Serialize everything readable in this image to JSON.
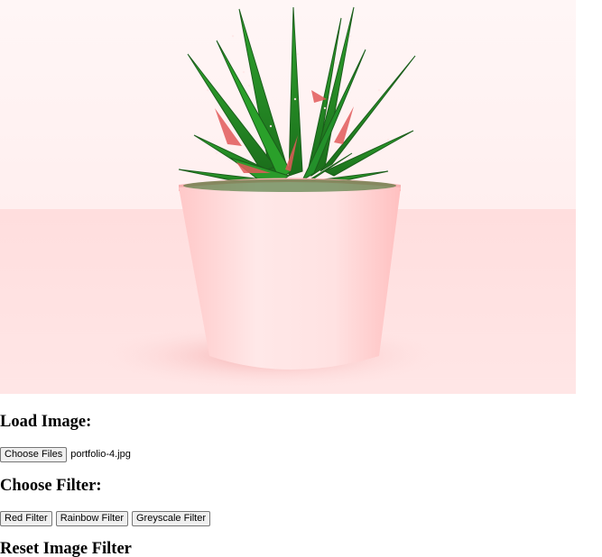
{
  "image": {
    "description_icon": "plant-photo",
    "colors": {
      "background_top": "#fff5f5",
      "background_bottom": "#ffdede",
      "pot": "#ffdcdc",
      "leaves": "#2a9d2a",
      "leaf_red": "#e05050"
    }
  },
  "load_section": {
    "heading": "Load Image:",
    "choose_button": "Choose Files",
    "file_name": "portfolio-4.jpg"
  },
  "filter_section": {
    "heading": "Choose Filter:",
    "buttons": [
      "Red Filter",
      "Rainbow Filter",
      "Greyscale Filter"
    ]
  },
  "reset_section": {
    "heading": "Reset Image Filter"
  }
}
